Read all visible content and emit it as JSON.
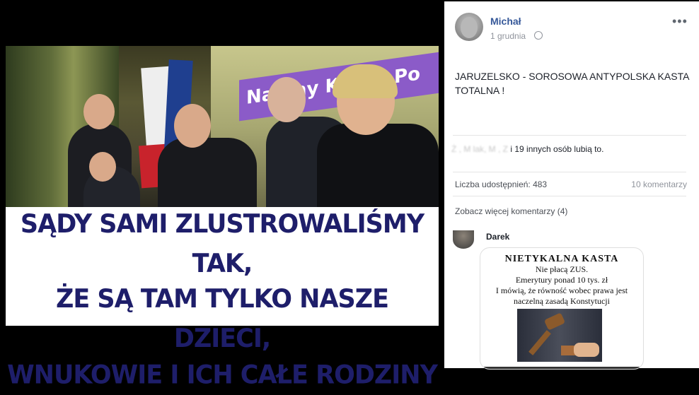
{
  "post": {
    "author": "Michał",
    "date": "1 grudnia",
    "text": "JARUZELSKO - SOROSOWA ANTYPOLSKA KASTA TOTALNA !",
    "more_menu": "•••"
  },
  "image": {
    "banner_text": "Nad   ny Ko     ów Po",
    "caption": [
      "SĄDY SAMI ZLUSTROWALIŚMY TAK,",
      "ŻE SĄ TAM TYLKO NASZE DZIECI,",
      "WNUKOWIE I ICH CAŁE RODZINY"
    ]
  },
  "reactions": {
    "likers_prefix": "Ż     ,      M     lak,  M   ,  Z     ",
    "likers_suffix": "i 19 innych osób lubią to."
  },
  "stats": {
    "shares": "Liczba udostępnień: 483",
    "comments": "10 komentarzy"
  },
  "comments": {
    "view_more": "Zobacz więcej komentarzy (4)",
    "first": {
      "author": "Darek",
      "card_title": "NIETYKALNA KASTA",
      "card_lines": [
        "Nie płacą ZUS.",
        "Emerytury ponad 10 tys. zł",
        "I mówią, że równość wobec prawa jest",
        "naczelną zasadą Konstytucji"
      ]
    }
  },
  "icons": {
    "globe": "globe-icon",
    "more": "more-options-icon"
  },
  "colors": {
    "link": "#365899",
    "caption_text": "#1e1e6a",
    "banner": "#8b5bc8"
  }
}
